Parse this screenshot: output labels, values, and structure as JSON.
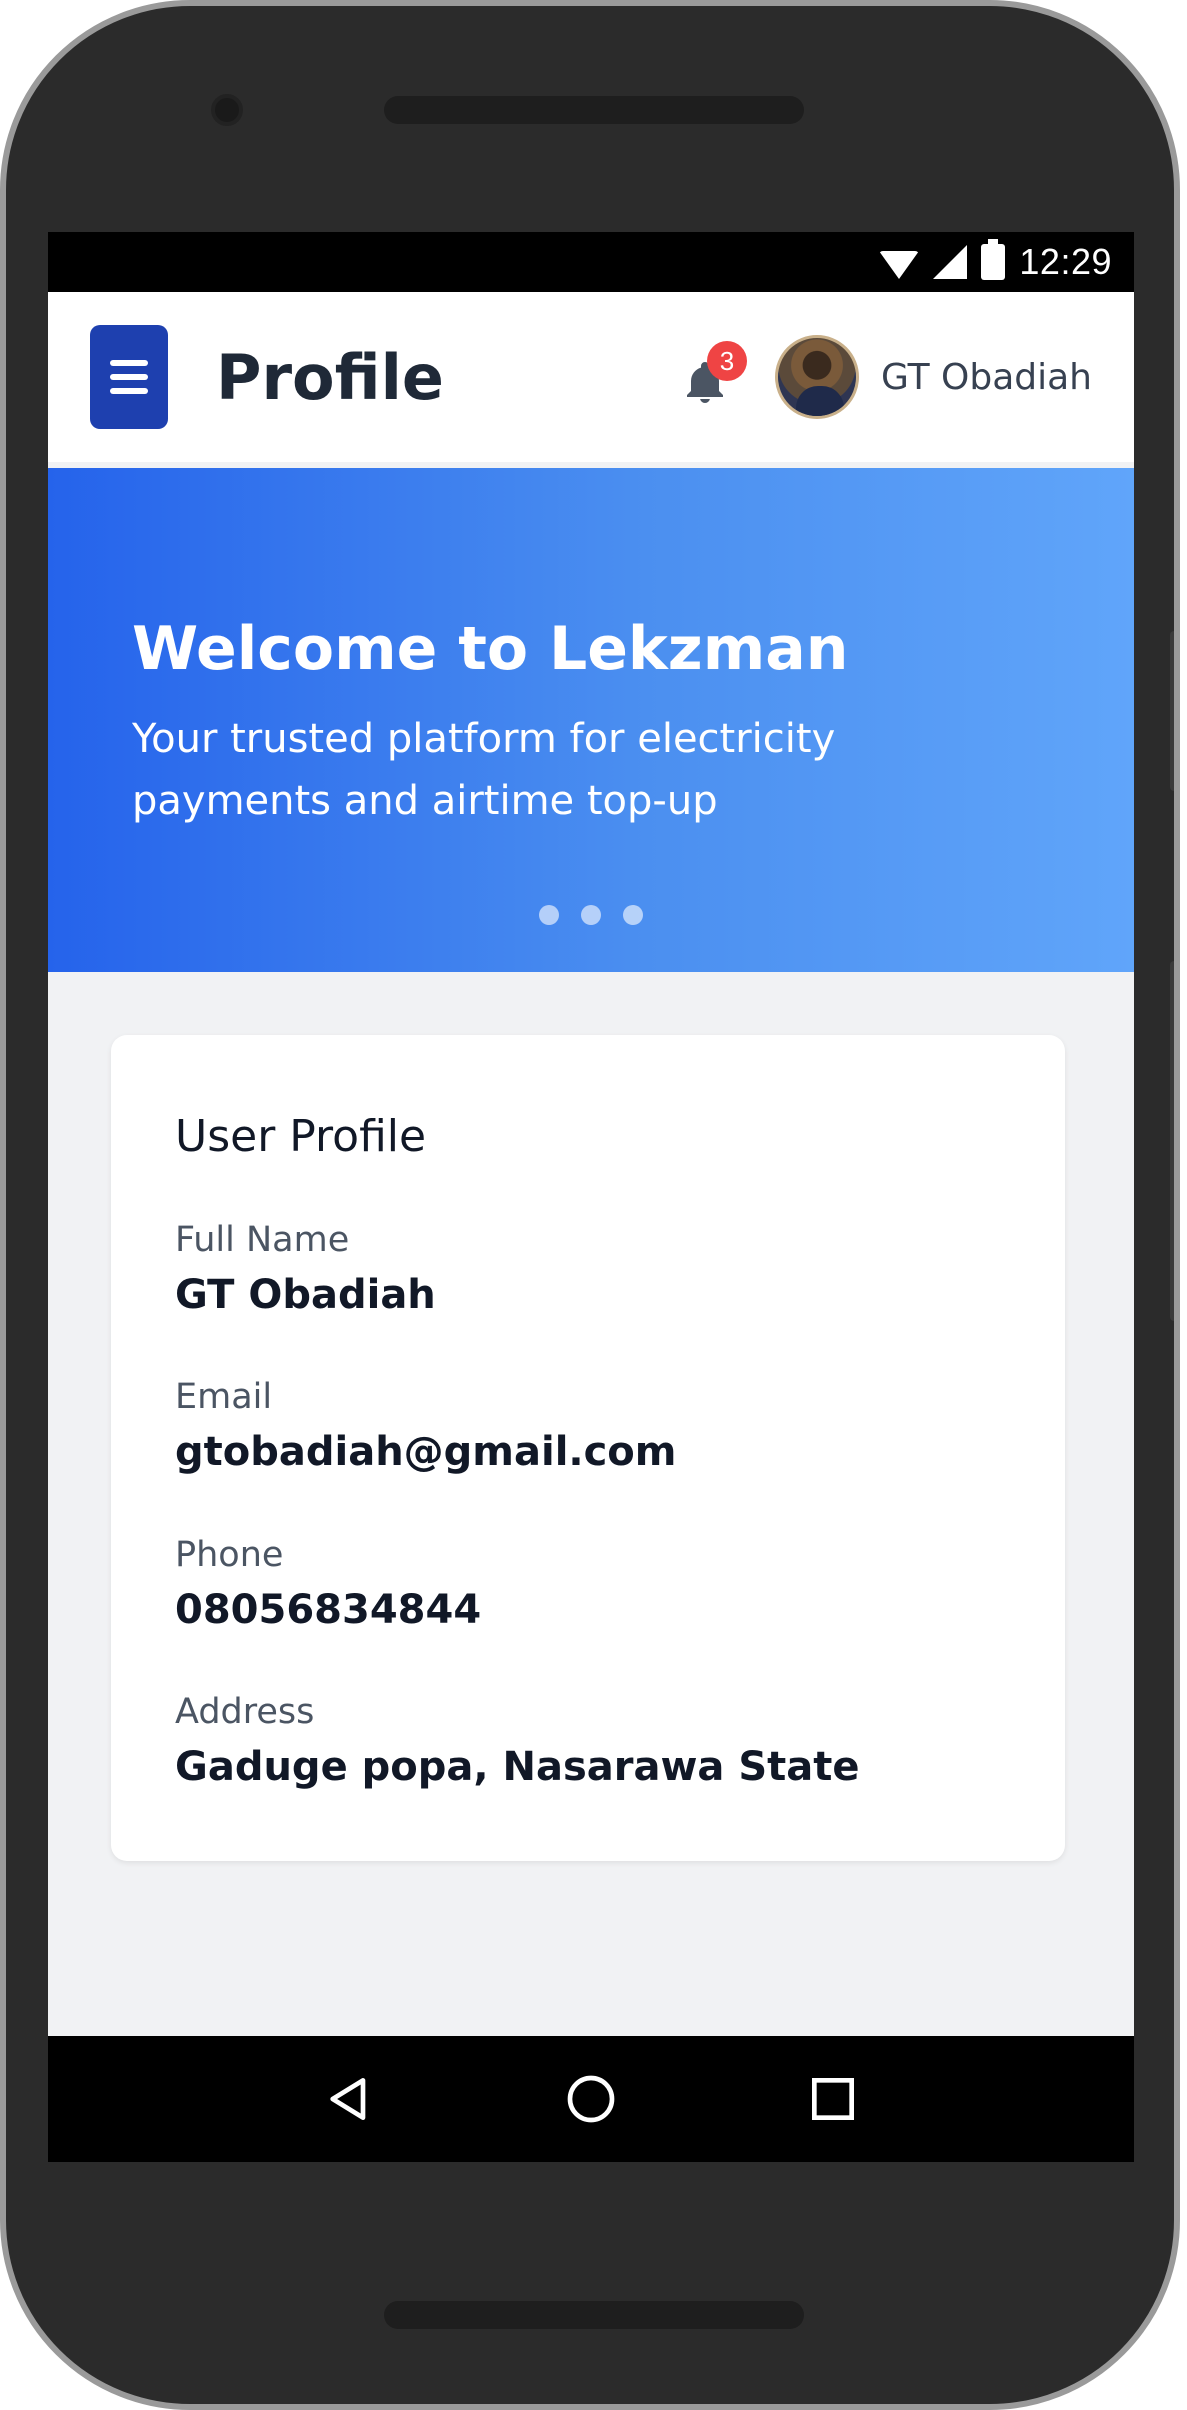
{
  "status_bar": {
    "time": "12:29",
    "icons": [
      "wifi-icon",
      "signal-icon",
      "battery-icon"
    ]
  },
  "header": {
    "title": "Profile",
    "menu_icon": "hamburger-menu-icon",
    "notification_count": "3",
    "user_name": "GT Obadiah"
  },
  "hero": {
    "title": "Welcome to Lekzman",
    "subtitle": "Your trusted platform for electricity payments and airtime top-up",
    "gradient": [
      "#2563eb",
      "#60a5fa"
    ],
    "slide_count": 3
  },
  "profile": {
    "title": "User Profile",
    "fields": [
      {
        "label": "Full Name",
        "value": "GT Obadiah"
      },
      {
        "label": "Email",
        "value": "gtobadiah@gmail.com"
      },
      {
        "label": "Phone",
        "value": "08056834844"
      },
      {
        "label": "Address",
        "value": "Gaduge popa, Nasarawa State"
      }
    ]
  },
  "nav_bar": {
    "buttons": [
      "back-icon",
      "home-icon",
      "recents-icon"
    ]
  },
  "colors": {
    "accent": "#1e40af",
    "badge": "#ef4444",
    "background": "#f1f2f4"
  }
}
